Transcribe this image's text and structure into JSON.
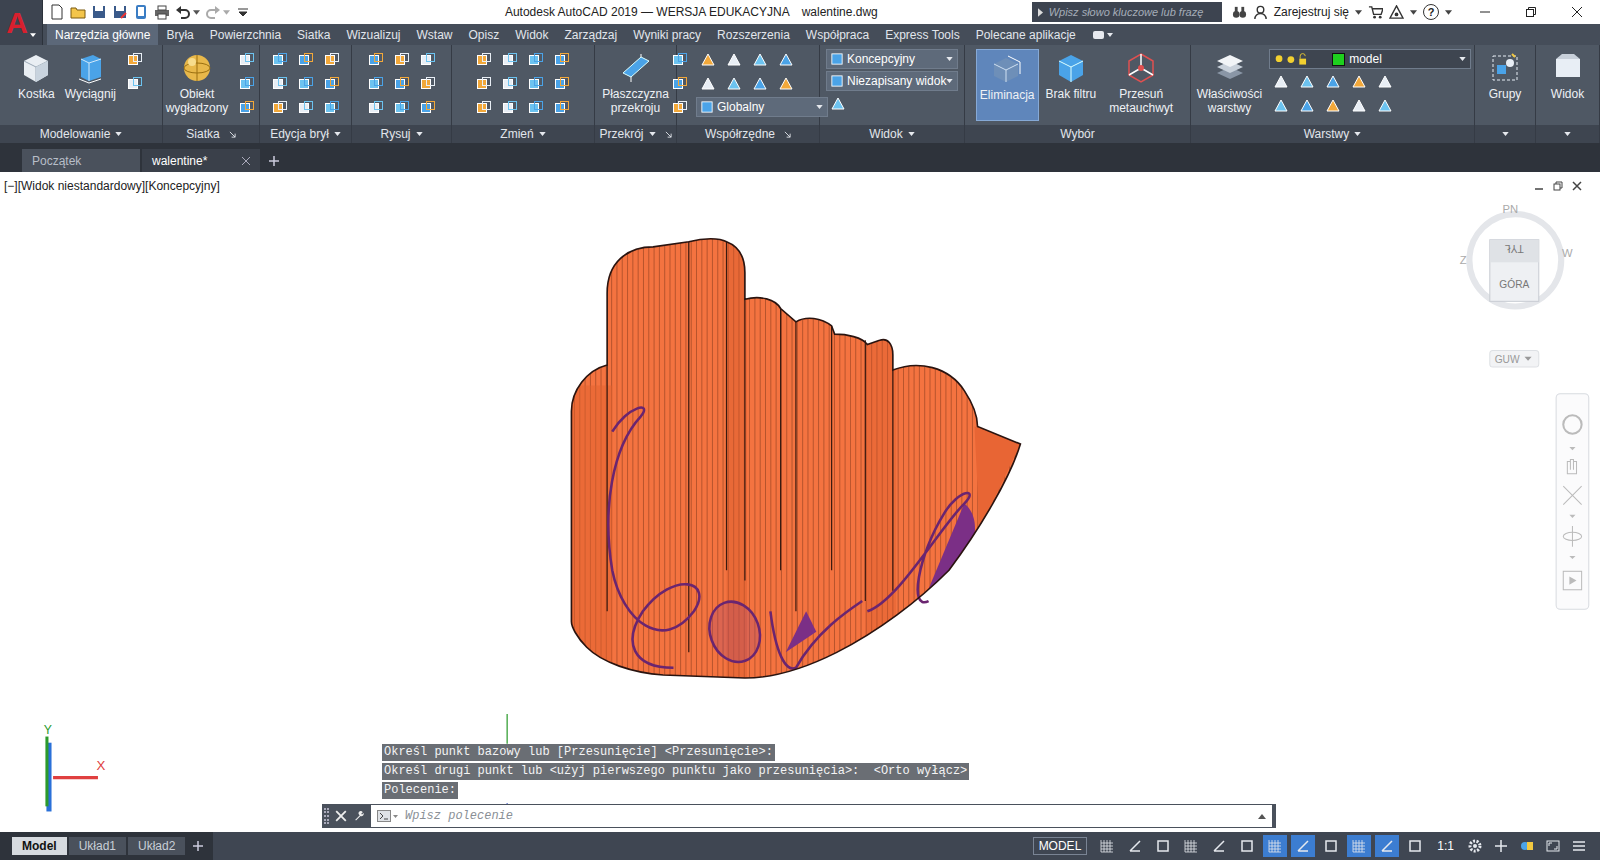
{
  "app": {
    "logo": "A",
    "title": "Autodesk AutoCAD 2019 — WERSJA EDUKACYJNA",
    "file": "walentine.dwg"
  },
  "search": {
    "placeholder": "Wpisz słowo kluczowe lub frazę"
  },
  "account": {
    "label": "Zarejestruj się"
  },
  "help": {
    "label": "?"
  },
  "ribbon_tabs": [
    {
      "label": "Narzędzia główne",
      "selected": true
    },
    {
      "label": "Bryła",
      "selected": false
    },
    {
      "label": "Powierzchnia",
      "selected": false
    },
    {
      "label": "Siatka",
      "selected": false
    },
    {
      "label": "Wizualizuj",
      "selected": false
    },
    {
      "label": "Wstaw",
      "selected": false
    },
    {
      "label": "Opisz",
      "selected": false
    },
    {
      "label": "Widok",
      "selected": false
    },
    {
      "label": "Zarządzaj",
      "selected": false
    },
    {
      "label": "Wyniki pracy",
      "selected": false
    },
    {
      "label": "Rozszerzenia",
      "selected": false
    },
    {
      "label": "Współpraca",
      "selected": false
    },
    {
      "label": "Express Tools",
      "selected": false
    },
    {
      "label": "Polecane aplikacje",
      "selected": false
    }
  ],
  "ribbon_groups": [
    {
      "title": "Modelowanie",
      "menu": true,
      "launcher": false,
      "buttons": [
        {
          "label": "Kostka",
          "selected": false
        },
        {
          "label": "Wyciągnij",
          "selected": false
        }
      ],
      "dropdowns": []
    },
    {
      "title": "Siatka",
      "menu": false,
      "launcher": true,
      "buttons": [
        {
          "label": "Obiekt wygładzony",
          "selected": false
        }
      ],
      "dropdowns": []
    },
    {
      "title": "Edycja brył",
      "menu": true,
      "launcher": false,
      "buttons": [],
      "dropdowns": []
    },
    {
      "title": "Rysuj",
      "menu": true,
      "launcher": false,
      "buttons": [],
      "dropdowns": []
    },
    {
      "title": "Zmień",
      "menu": true,
      "launcher": false,
      "buttons": [],
      "dropdowns": []
    },
    {
      "title": "Przekrój",
      "menu": true,
      "launcher": true,
      "buttons": [
        {
          "label": "Płaszczyzna przekroju",
          "selected": false
        }
      ],
      "dropdowns": []
    },
    {
      "title": "Współrzędne",
      "menu": false,
      "launcher": true,
      "buttons": [],
      "dropdowns": [
        {
          "value": "Globalny"
        }
      ]
    },
    {
      "title": "Widok",
      "menu": true,
      "launcher": false,
      "buttons": [],
      "dropdowns": [
        {
          "value": "Koncepcyjny"
        },
        {
          "value": "Niezapisany widok"
        }
      ]
    },
    {
      "title": "Wybór",
      "menu": false,
      "launcher": false,
      "buttons": [
        {
          "label": "Eliminacja",
          "selected": true
        },
        {
          "label": "Brak filtru",
          "selected": false
        },
        {
          "label": "Przesuń metauchwyt",
          "selected": false
        }
      ],
      "dropdowns": []
    },
    {
      "title": "Warstwy",
      "menu": true,
      "launcher": false,
      "buttons": [
        {
          "label": "Właściwości warstwy",
          "selected": false
        }
      ],
      "dropdowns": [
        {
          "value": "model",
          "color": "#1ed01e"
        }
      ]
    },
    {
      "title": "",
      "menu": true,
      "launcher": false,
      "buttons": [
        {
          "label": "Grupy",
          "selected": false
        }
      ],
      "dropdowns": []
    },
    {
      "title": "",
      "menu": true,
      "launcher": false,
      "buttons": [
        {
          "label": "Widok",
          "selected": false
        }
      ],
      "dropdowns": []
    }
  ],
  "doc_tabs": [
    {
      "label": "Początek",
      "selected": false
    },
    {
      "label": "walentine*",
      "selected": true
    }
  ],
  "viewport": {
    "label": "[−][Widok niestandardowy][Koncepcyjny]"
  },
  "viewcube": {
    "north": "PN",
    "west": "Z",
    "east": "W",
    "face_top": "GÓRA",
    "face_back": "TYŁ",
    "ucs": "GUW"
  },
  "ucs_icon": {
    "y": "Y",
    "x": "X"
  },
  "command": {
    "history": [
      "Określ punkt bazowy lub [Przesunięcie] <Przesunięcie>:",
      "Określ drugi punkt lub <użyj pierwszego punktu jako przesunięcia>:  <Orto wyłącz>",
      "Polecenie:"
    ],
    "placeholder": "Wpisz polecenie"
  },
  "status": {
    "layouts": [
      {
        "label": "Model",
        "selected": true
      },
      {
        "label": "Układ1",
        "selected": false
      },
      {
        "label": "Układ2",
        "selected": false
      }
    ],
    "mode": "MODEL",
    "scale": "1:1",
    "toggles": [
      {
        "on": false
      },
      {
        "on": false
      },
      {
        "on": false
      },
      {
        "on": false
      },
      {
        "on": false
      },
      {
        "on": false
      },
      {
        "on": true
      },
      {
        "on": true
      },
      {
        "on": false
      },
      {
        "on": true
      },
      {
        "on": true
      },
      {
        "on": false
      }
    ]
  }
}
